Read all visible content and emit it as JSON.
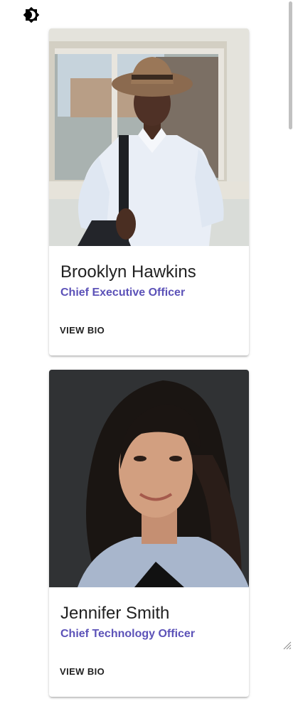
{
  "theme_toggle": {
    "icon": "brightness-icon"
  },
  "team": [
    {
      "name": "Brooklyn Hawkins",
      "role": "Chief Executive Officer",
      "action_label": "VIEW BIO",
      "photo": "man-with-hat-and-backpack"
    },
    {
      "name": "Jennifer Smith",
      "role": "Chief Technology Officer",
      "action_label": "VIEW BIO",
      "photo": "woman-with-dark-hair"
    }
  ],
  "colors": {
    "role_text": "#5c52b8",
    "name_text": "#212121"
  }
}
